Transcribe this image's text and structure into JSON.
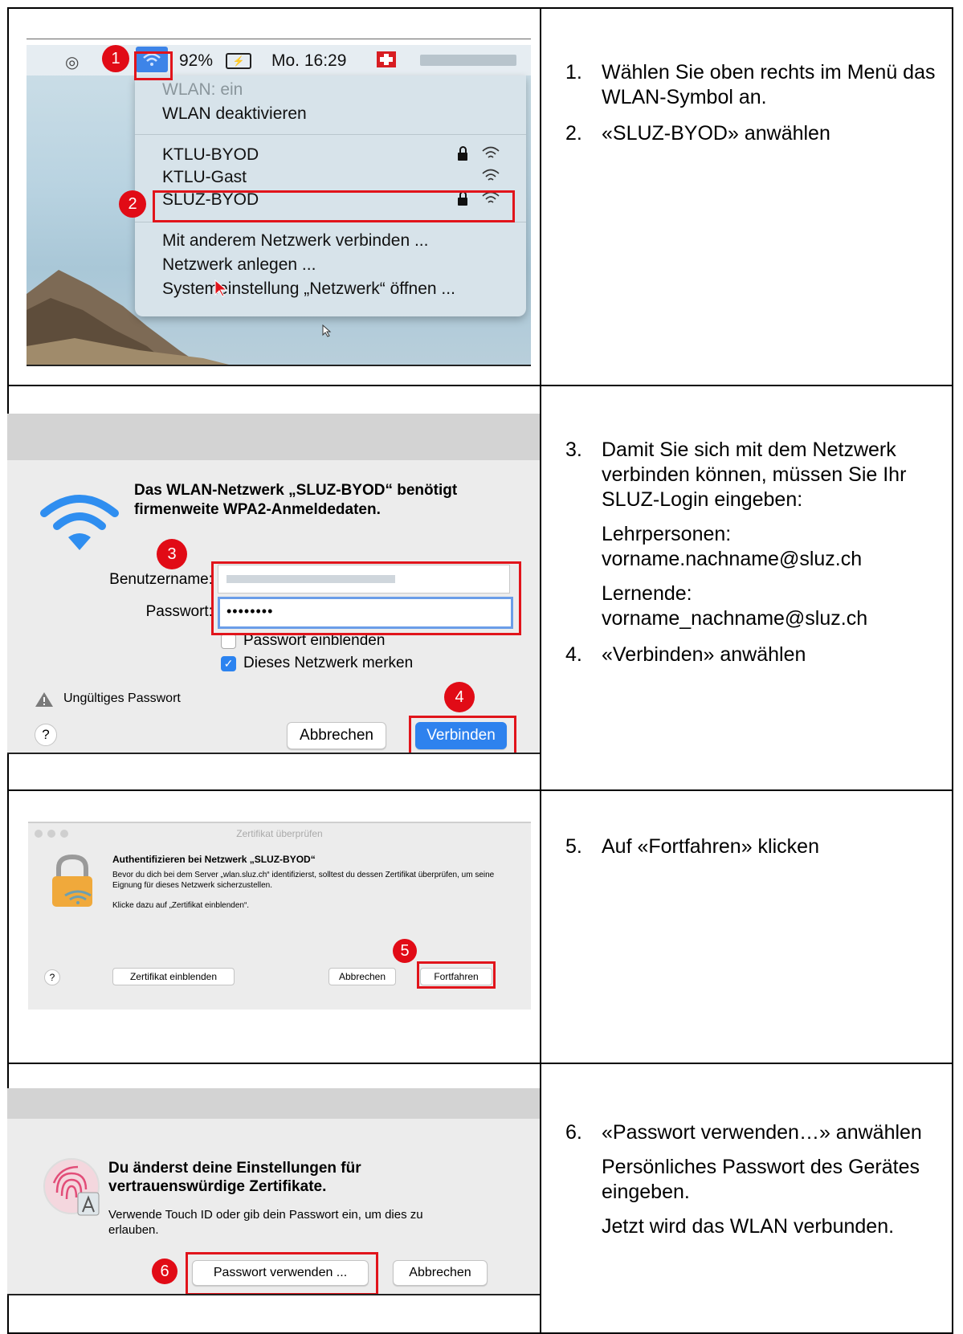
{
  "row1": {
    "menubar": {
      "battery": "92%",
      "clock": "Mo. 16:29"
    },
    "menu": {
      "status": "WLAN: ein",
      "toggle": "WLAN deaktivieren",
      "networks": [
        "KTLU-BYOD",
        "KTLU-Gast",
        "SLUZ-BYOD"
      ],
      "actions": [
        "Mit anderem Netzwerk verbinden ...",
        "Netzwerk anlegen ...",
        "Systemeinstellung „Netzwerk“ öffnen ..."
      ]
    },
    "badges": [
      "1",
      "2"
    ],
    "steps": [
      {
        "num": "1.",
        "text": "Wählen Sie oben rechts im Menü das WLAN-Symbol an."
      },
      {
        "num": "2.",
        "text": "«SLUZ-BYOD» anwählen"
      }
    ]
  },
  "row2": {
    "dialog": {
      "heading": "Das WLAN-Netzwerk „SLUZ-BYOD“ benötigt firmenweite WPA2-Anmeldedaten.",
      "username_label": "Benutzername:",
      "password_label": "Passwort:",
      "password_value": "••••••••",
      "show_password": "Passwort einblenden",
      "remember": "Dieses Netzwerk merken",
      "error": "Ungültiges Passwort",
      "help": "?",
      "cancel": "Abbrechen",
      "connect": "Verbinden"
    },
    "badges": [
      "3",
      "4"
    ],
    "steps": {
      "s3_num": "3.",
      "s3_text": "Damit Sie sich mit dem Netzwerk verbinden können, müssen Sie Ihr SLUZ-Login eingeben:",
      "teachers_label": "Lehrpersonen:",
      "teachers_value": "vorname.nachname@sluz.ch",
      "students_label": "Lernende:",
      "students_value": "vorname_nachname@sluz.ch",
      "s4_num": "4.",
      "s4_text": "«Verbinden» anwählen"
    }
  },
  "row3": {
    "dialog": {
      "window_title": "Zertifikat überprüfen",
      "heading": "Authentifizieren bei Netzwerk „SLUZ-BYOD“",
      "body": "Bevor du dich bei dem Server „wlan.sluz.ch“ identifizierst, solltest du dessen Zertifikat überprüfen, um seine Eignung für dieses Netzwerk sicherzustellen.",
      "hint": "Klicke dazu auf „Zertifikat einblenden“.",
      "help": "?",
      "show_cert": "Zertifikat einblenden",
      "cancel": "Abbrechen",
      "continue": "Fortfahren"
    },
    "badges": [
      "5"
    ],
    "steps": [
      {
        "num": "5.",
        "text": "Auf «Fortfahren» klicken"
      }
    ]
  },
  "row4": {
    "dialog": {
      "heading": "Du änderst deine Einstellungen für vertrauenswürdige Zertifikate.",
      "body": "Verwende Touch ID oder gib dein Passwort ein, um dies zu erlauben.",
      "use_password": "Passwort verwenden ...",
      "cancel": "Abbrechen"
    },
    "badges": [
      "6"
    ],
    "steps": {
      "s6_num": "6.",
      "s6_text": "«Passwort verwenden…» anwählen",
      "p1": "Persönliches Passwort des Gerätes eingeben.",
      "p2": "Jetzt wird das WLAN verbunden."
    }
  },
  "colors": {
    "badge_red": "#e10b16",
    "mac_blue": "#2e82ee"
  }
}
